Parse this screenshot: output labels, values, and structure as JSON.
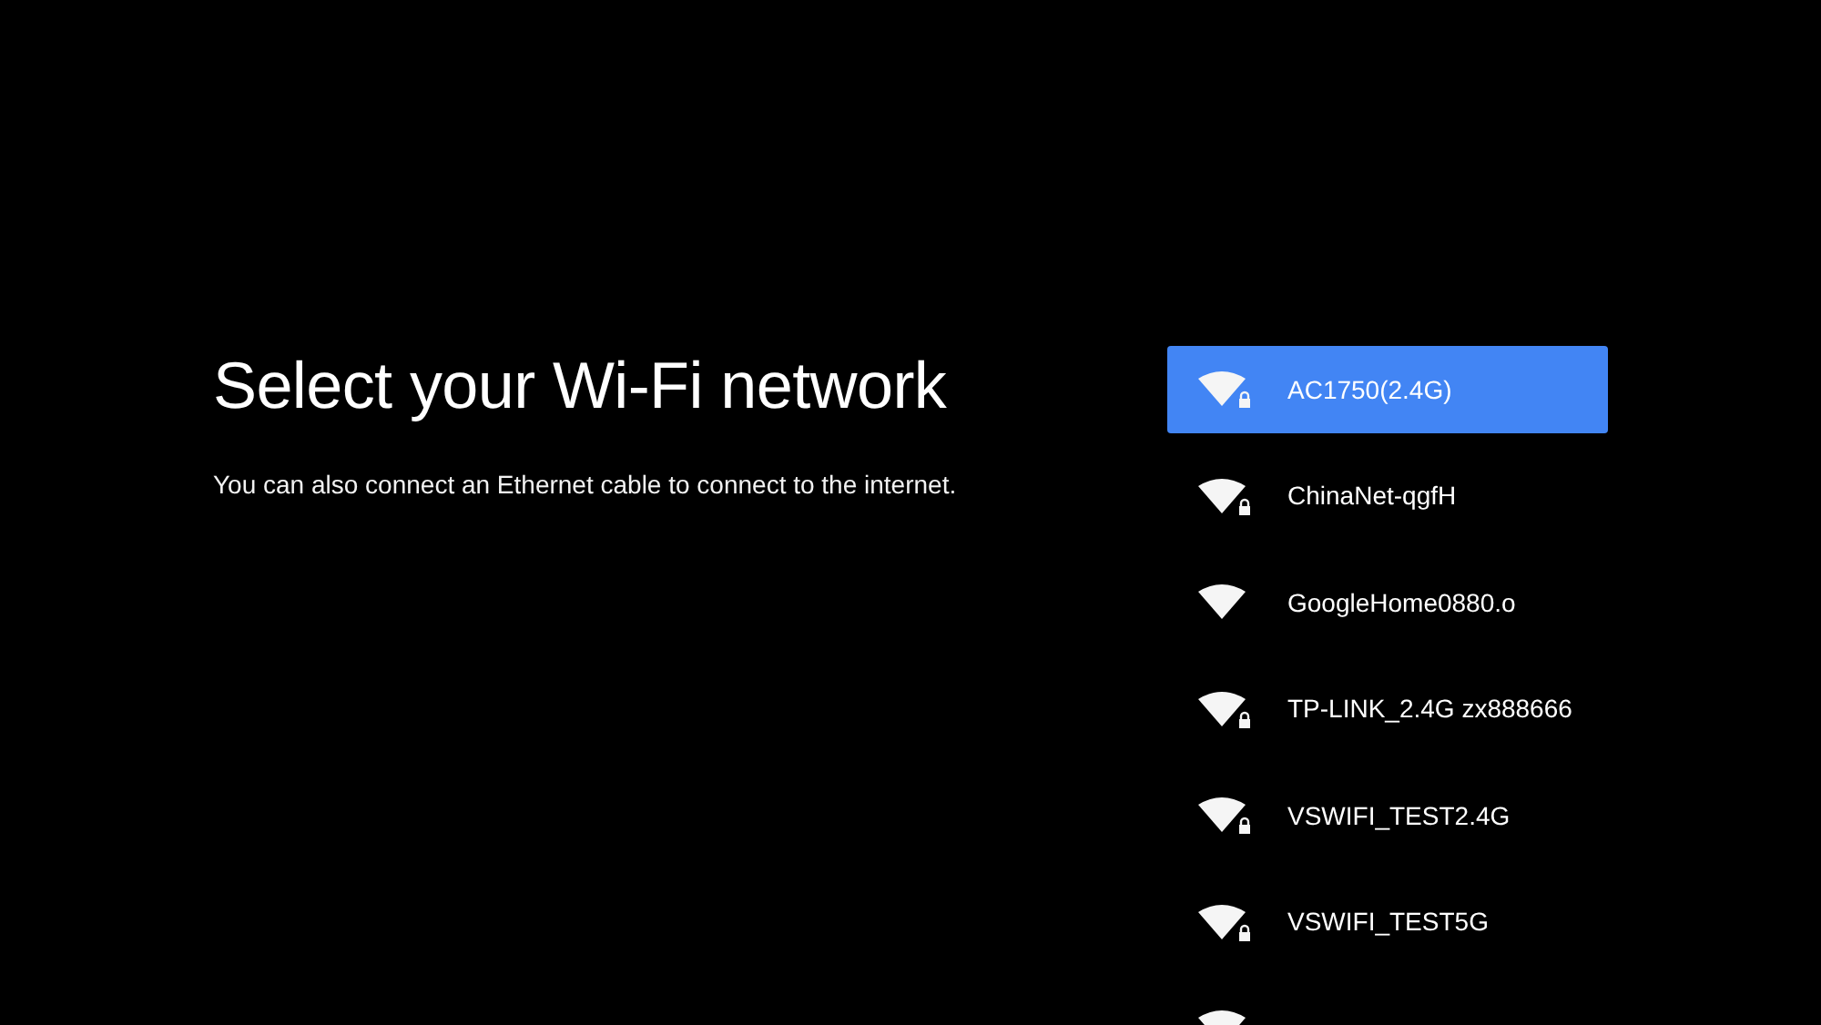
{
  "heading": "Select your Wi-Fi network",
  "subtitle": "You can also connect an Ethernet cable to connect to the internet.",
  "networks": [
    {
      "name": "AC1750(2.4G)",
      "locked": true,
      "selected": true
    },
    {
      "name": "ChinaNet-qgfH",
      "locked": true,
      "selected": false
    },
    {
      "name": "GoogleHome0880.o",
      "locked": false,
      "selected": false
    },
    {
      "name": "TP-LINK_2.4G zx888666",
      "locked": true,
      "selected": false
    },
    {
      "name": "VSWIFI_TEST2.4G",
      "locked": true,
      "selected": false
    },
    {
      "name": "VSWIFI_TEST5G",
      "locked": true,
      "selected": false
    },
    {
      "selected": false
    }
  ]
}
